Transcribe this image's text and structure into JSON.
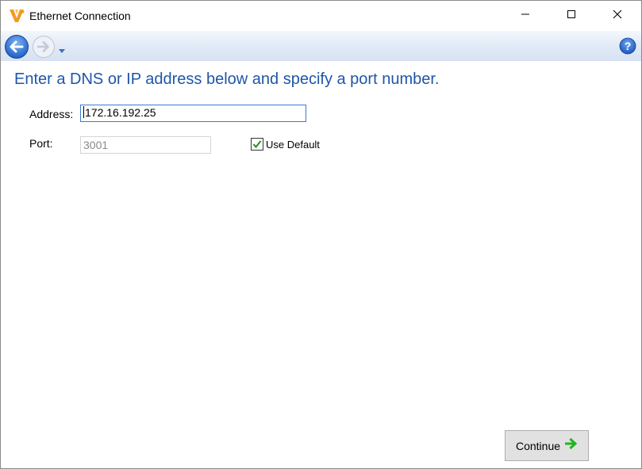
{
  "window": {
    "title": "Ethernet Connection",
    "icon": "v-logo-icon"
  },
  "titlebar_buttons": {
    "minimize": "minimize-icon",
    "maximize": "maximize-icon",
    "close": "close-icon"
  },
  "navbar": {
    "back": "back-arrow-icon",
    "forward": "forward-arrow-icon",
    "dropdown": "chevron-down-icon",
    "help": "help-icon"
  },
  "main": {
    "heading": "Enter a DNS or IP address below and specify a port number.",
    "address_label": "Address:",
    "address_value": "172.16.192.25",
    "port_label": "Port:",
    "port_value": "3001",
    "use_default_label": "Use Default",
    "use_default_checked": true
  },
  "footer": {
    "continue_label": "Continue",
    "continue_icon": "green-right-arrow-icon"
  },
  "colors": {
    "heading": "#1f56a8",
    "focus_border": "#3b7ad4",
    "arrow_green": "#22b422",
    "back_blue": "#2e6fd0"
  }
}
